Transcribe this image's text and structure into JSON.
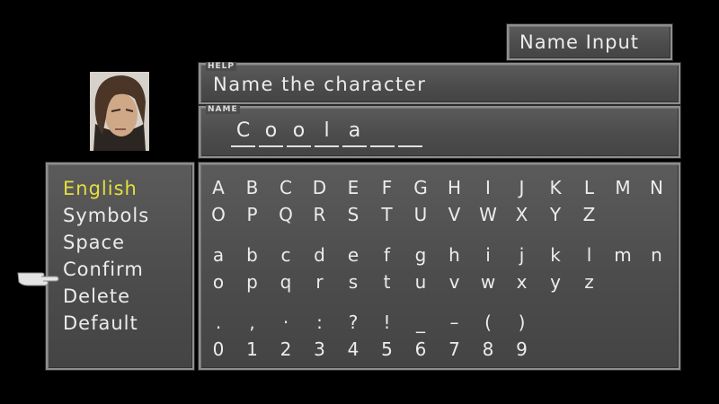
{
  "screen": {
    "title": "Name Input"
  },
  "help": {
    "tag": "HELP",
    "text": "Name the character"
  },
  "name": {
    "tag": "NAME",
    "slots": [
      "C",
      "o",
      "o",
      "l",
      "a",
      "",
      ""
    ]
  },
  "menu": {
    "items": [
      "English",
      "Symbols",
      "Space",
      "Confirm",
      "Delete",
      "Default"
    ],
    "selected": "English",
    "cursor_on": "Confirm"
  },
  "keyboard": {
    "rows": [
      [
        "A",
        "B",
        "C",
        "D",
        "E",
        "F",
        "G",
        "H",
        "I",
        "J",
        "K",
        "L",
        "M",
        "N"
      ],
      [
        "O",
        "P",
        "Q",
        "R",
        "S",
        "T",
        "U",
        "V",
        "W",
        "X",
        "Y",
        "Z"
      ],
      [
        "a",
        "b",
        "c",
        "d",
        "e",
        "f",
        "g",
        "h",
        "i",
        "j",
        "k",
        "l",
        "m",
        "n"
      ],
      [
        "o",
        "p",
        "q",
        "r",
        "s",
        "t",
        "u",
        "v",
        "w",
        "x",
        "y",
        "z"
      ],
      [
        ".",
        ",",
        "·",
        ":",
        "?",
        "!",
        "_",
        "–",
        "(",
        ")"
      ],
      [
        "0",
        "1",
        "2",
        "3",
        "4",
        "5",
        "6",
        "7",
        "8",
        "9"
      ]
    ]
  },
  "colors": {
    "selected_text": "#e6df3c",
    "window_bg": "#4c4c4c",
    "border": "#8e8e8e"
  },
  "icons": {
    "cursor": "pointing-hand-icon",
    "portrait": "character-portrait"
  }
}
